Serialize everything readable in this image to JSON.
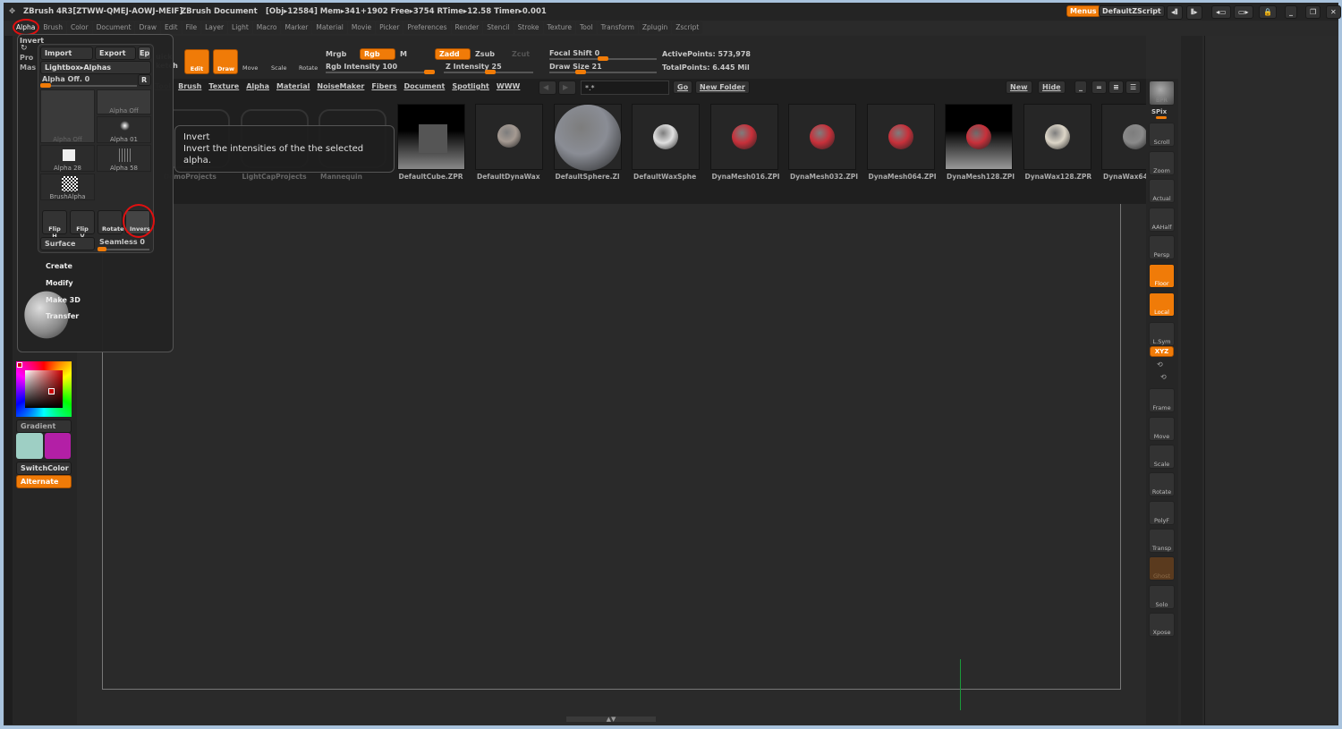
{
  "title_bar": {
    "app": "ZBrush 4R3[ZTWW-QMEJ-AOWJ-MEIF]",
    "document": "ZBrush Document",
    "stats": "[Obj▸12584] Mem▸341+1902 Free▸3754 RTime▸12.58 Timer▸0.001",
    "menus_btn": "Menus",
    "script": "DefaultZScript"
  },
  "menu": [
    "Alpha",
    "Brush",
    "Color",
    "Document",
    "Draw",
    "Edit",
    "File",
    "Layer",
    "Light",
    "Macro",
    "Marker",
    "Material",
    "Movie",
    "Picker",
    "Preferences",
    "Render",
    "Stencil",
    "Stroke",
    "Texture",
    "Tool",
    "Transform",
    "Zplugin",
    "Zscript"
  ],
  "toolbar": {
    "proj": "Pro",
    "mask": "Mas",
    "quick": "uick",
    "sketch": "ketch",
    "edit": "Edit",
    "draw": "Draw",
    "move": "Move",
    "scale": "Scale",
    "rotate": "Rotate",
    "mrgb": "Mrgb",
    "rgb": "Rgb",
    "m": "M",
    "zadd": "Zadd",
    "zsub": "Zsub",
    "zcut": "Zcut",
    "rgb_intensity": "Rgb Intensity 100",
    "z_intensity": "Z Intensity 25",
    "focal_shift": "Focal Shift 0",
    "draw_size": "Draw Size 21",
    "active_points": "ActivePoints: 573,978",
    "total_points": "TotalPoints: 6.445 Mil",
    "rgb_intensity_value": 100,
    "z_intensity_value": 25,
    "draw_size_value": 21
  },
  "lightbox": {
    "tabs": [
      "Tool",
      "Brush",
      "Texture",
      "Alpha",
      "Material",
      "NoiseMaker",
      "Fibers",
      "Document",
      "Spotlight",
      "WWW"
    ],
    "search": "*.*",
    "go": "Go",
    "new_folder": "New Folder",
    "new": "New",
    "hide": "Hide",
    "items": [
      "DemoProjects",
      "LightCapProjects",
      "Mannequin",
      "DefaultCube.ZPR",
      "DefaultDynaWax",
      "DefaultSphere.ZI",
      "DefaultWaxSphe",
      "DynaMesh016.ZPI",
      "DynaMesh032.ZPI",
      "DynaMesh064.ZPI",
      "DynaMesh128.ZPI",
      "DynaWax128.ZPR",
      "DynaWax64"
    ]
  },
  "tooltip": {
    "title": "Invert",
    "text": "Invert the intensities of the the selected alpha."
  },
  "alpha_popup": {
    "title": "Invert",
    "import": "Import",
    "export": "Export",
    "ep": "Ep",
    "lightbox": "Lightbox▸Alphas",
    "alpha_off": "Alpha Off. 0",
    "r": "R",
    "cells": [
      "Alpha Off",
      "Alpha Off",
      "Alpha 01",
      "Alpha 28",
      "Alpha 58",
      "BrushAlpha"
    ],
    "flip_h": "Flip H",
    "flip_v": "Flip V",
    "rotate": "Rotate",
    "invers": "Invers",
    "surface": "Surface",
    "seamless": "Seamless 0",
    "create": "Create",
    "modify": "Modify",
    "make3d": "Make 3D",
    "transfer": "Transfer"
  },
  "color": {
    "gradient": "Gradient",
    "switch": "SwitchColor",
    "alternate": "Alternate",
    "main": "#9ecfc4",
    "secondary": "#b31fa6"
  },
  "right_shelf": [
    "BPR",
    "SPix",
    "Scroll",
    "Zoom",
    "Actual",
    "AAHalf",
    "Persp",
    "Floor",
    "Local",
    "L.Sym",
    "XYZ",
    "Frame",
    "Move",
    "Scale",
    "Rotate",
    "PolyF",
    "Transp",
    "Ghost",
    "Solo",
    "Xpose"
  ],
  "colors": {
    "accent": "#f07b08",
    "highlight": "#e01010"
  }
}
